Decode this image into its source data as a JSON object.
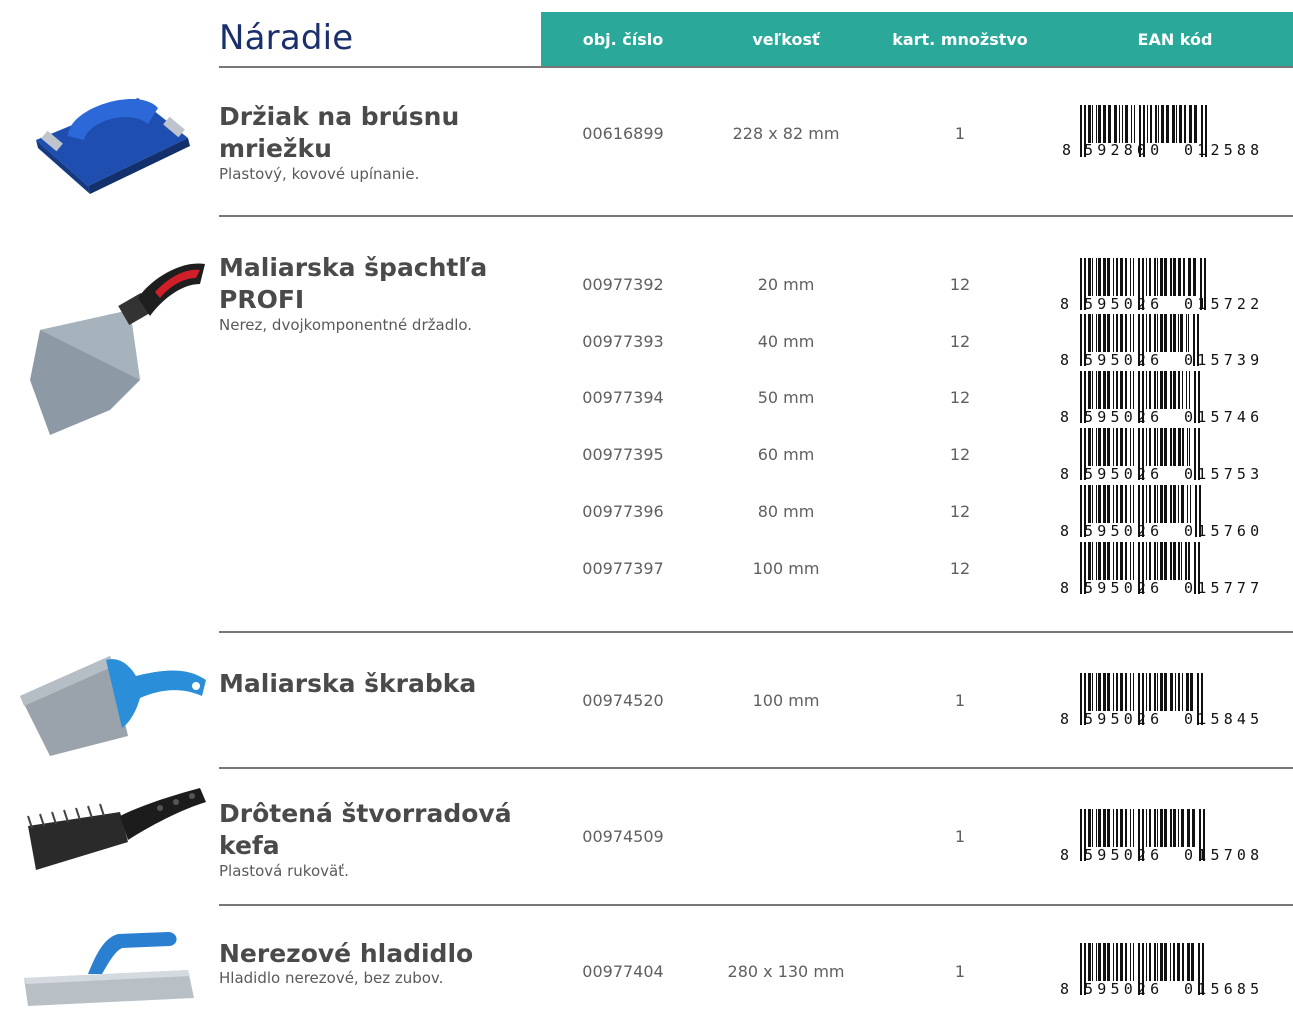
{
  "title": "Náradie",
  "columns": {
    "code": "obj. číslo",
    "size": "veľkosť",
    "qty": "kart. množstvo",
    "ean": "EAN kód"
  },
  "products": [
    {
      "name": "Držiak na brúsnu mriežku",
      "description": "Plastový, kovové upínanie.",
      "image_icon": "sanding-holder-icon",
      "variants": [
        {
          "code": "00616899",
          "size": "228 x 82 mm",
          "qty": "1",
          "ean_first": "8",
          "ean_left": "592800",
          "ean_right": "012588"
        }
      ]
    },
    {
      "name": "Maliarska špachtľa PROFI",
      "description": "Nerez, dvojkomponentné držadlo.",
      "image_icon": "putty-knife-icon",
      "variants": [
        {
          "code": "00977392",
          "size": "20 mm",
          "qty": "12",
          "ean_first": "8",
          "ean_left": "595026",
          "ean_right": "015722"
        },
        {
          "code": "00977393",
          "size": "40 mm",
          "qty": "12",
          "ean_first": "8",
          "ean_left": "595026",
          "ean_right": "015739"
        },
        {
          "code": "00977394",
          "size": "50 mm",
          "qty": "12",
          "ean_first": "8",
          "ean_left": "595026",
          "ean_right": "015746"
        },
        {
          "code": "00977395",
          "size": "60 mm",
          "qty": "12",
          "ean_first": "8",
          "ean_left": "595026",
          "ean_right": "015753"
        },
        {
          "code": "00977396",
          "size": "80 mm",
          "qty": "12",
          "ean_first": "8",
          "ean_left": "595026",
          "ean_right": "015760"
        },
        {
          "code": "00977397",
          "size": "100 mm",
          "qty": "12",
          "ean_first": "8",
          "ean_left": "595026",
          "ean_right": "015777"
        }
      ]
    },
    {
      "name": "Maliarska škrabka",
      "description": "",
      "image_icon": "scraper-icon",
      "variants": [
        {
          "code": "00974520",
          "size": "100 mm",
          "qty": "1",
          "ean_first": "8",
          "ean_left": "595026",
          "ean_right": "015845"
        }
      ]
    },
    {
      "name": "Drôtená štvorradová kefa",
      "description": "Plastová rukoväť.",
      "image_icon": "wire-brush-icon",
      "variants": [
        {
          "code": "00974509",
          "size": "",
          "qty": "1",
          "ean_first": "8",
          "ean_left": "595026",
          "ean_right": "015708"
        }
      ]
    },
    {
      "name": "Nerezové hladidlo",
      "description": "Hladidlo nerezové, bez zubov.",
      "image_icon": "trowel-icon",
      "variants": [
        {
          "code": "00977404",
          "size": "280 x 130 mm",
          "qty": "1",
          "ean_first": "8",
          "ean_left": "595026",
          "ean_right": "015685"
        }
      ]
    }
  ]
}
